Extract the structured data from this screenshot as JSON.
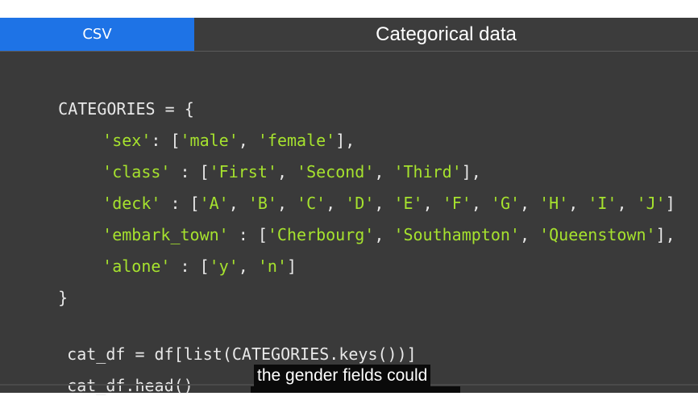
{
  "tabs": {
    "csv_label": "CSV",
    "title": "Categorical data"
  },
  "code": {
    "l1": "CATEGORIES = {",
    "l2": {
      "k": "'sex'",
      "a": ": [",
      "v1": "'male'",
      "s1": ", ",
      "v2": "'female'",
      "end": "],"
    },
    "l3": {
      "k": "'class'",
      "a": " : [",
      "v1": "'First'",
      "s1": ", ",
      "v2": "'Second'",
      "s2": ", ",
      "v3": "'Third'",
      "end": "],"
    },
    "l4": {
      "k": "'deck'",
      "a": " : [",
      "vals": [
        "'A'",
        "'B'",
        "'C'",
        "'D'",
        "'E'",
        "'F'",
        "'G'",
        "'H'",
        "'I'",
        "'J'"
      ],
      "end": "]"
    },
    "l5": {
      "k": "'embark_town'",
      "a": " : [",
      "v1": "'Cherbourg'",
      "s1": ", ",
      "v2": "'Southampton'",
      "s2": ", ",
      "v3": "'Queenstown'",
      "end": "],"
    },
    "l6": {
      "k": "'alone'",
      "a": " : [",
      "v1": "'y'",
      "s1": ", ",
      "v2": "'n'",
      "end": "]"
    },
    "l7": "}",
    "l8": "cat_df = df[list(CATEGORIES.keys())]",
    "l9": "cat_df.head()"
  },
  "caption": "the gender fields could",
  "colors": {
    "tab_active": "#1e73e6",
    "string": "#a6e22e",
    "background": "#3a3a3a"
  }
}
